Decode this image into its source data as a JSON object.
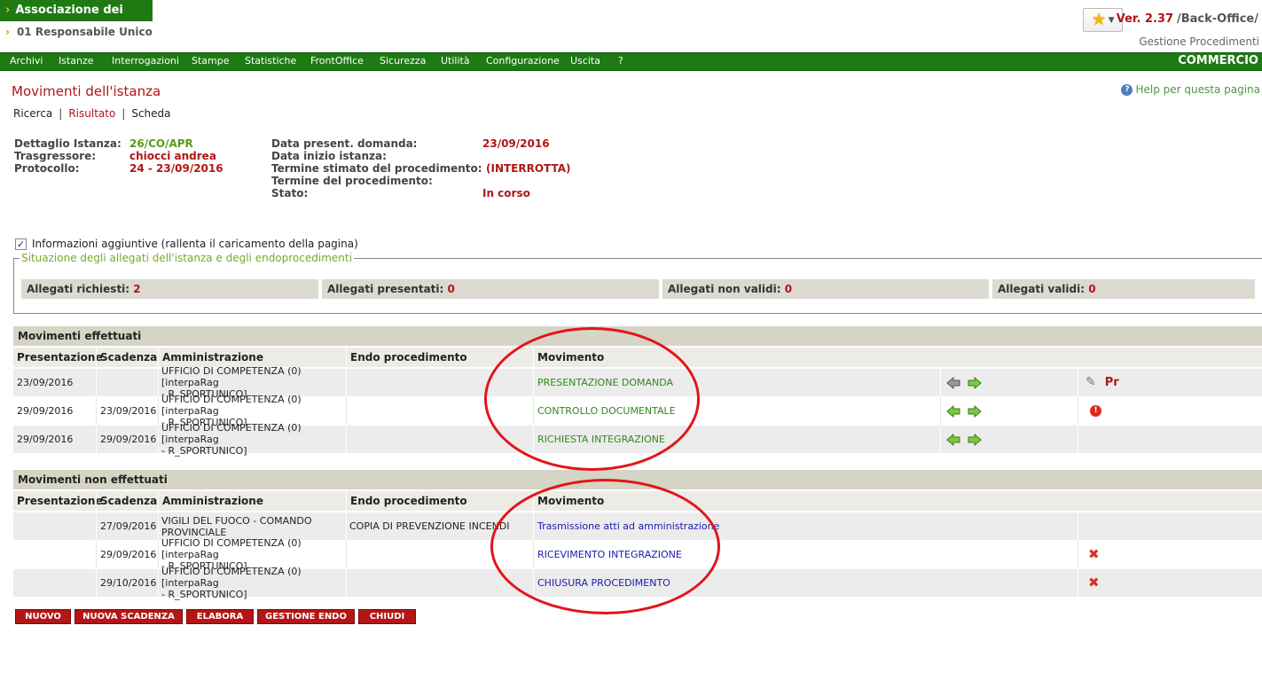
{
  "header": {
    "org_name": "Associazione dei comuni",
    "user": "01 Responsabile Unico",
    "version": "Ver. 2.37",
    "app": "/Back-Office/",
    "module": "Gestione Procedimenti"
  },
  "nav": {
    "items": [
      "Archivi",
      "Istanze",
      "Interrogazioni",
      "Stampe",
      "Statistiche",
      "FrontOffice",
      "Sicurezza",
      "Utilità",
      "Configurazione",
      "Uscita",
      "?"
    ],
    "right_label": "COMMERCIO"
  },
  "page": {
    "title": "Movimenti dell'istanza",
    "help": "Help per questa pagina",
    "breadcrumb": [
      "Ricerca",
      "Risultato",
      "Scheda"
    ]
  },
  "detail": {
    "left": [
      {
        "label": "Dettaglio Istanza:",
        "value": "26/CO/APR"
      },
      {
        "label": "Trasgressore:",
        "value": "chiocci andrea"
      },
      {
        "label": "Protocollo:",
        "value": "24 - 23/09/2016"
      }
    ],
    "right": [
      {
        "label": "Data present. domanda:",
        "value": "23/09/2016"
      },
      {
        "label": "Data inizio istanza:",
        "value": ""
      },
      {
        "label": "Termine stimato del procedimento:",
        "value": "(INTERROTTA)"
      },
      {
        "label": "Termine del procedimento:",
        "value": ""
      },
      {
        "label": "Stato:",
        "value": "In corso"
      }
    ]
  },
  "info": {
    "checkbox_label": "Informazioni aggiuntive (rallenta il caricamento della pagina)",
    "checked": true,
    "legend": "Situazione degli allegati dell'istanza e degli endoprocedimenti",
    "allegati": [
      {
        "label": "Allegati richiesti:",
        "value": "2"
      },
      {
        "label": "Allegati presentati:",
        "value": "0"
      },
      {
        "label": "Allegati non validi:",
        "value": "0"
      },
      {
        "label": "Allegati validi:",
        "value": "0"
      }
    ]
  },
  "columns": [
    "Presentazione",
    "Scadenza",
    "Amministrazione",
    "Endo procedimento",
    "Movimento"
  ],
  "effettuati": {
    "title": "Movimenti effettuati",
    "rows": [
      {
        "presentazione": "23/09/2016",
        "scadenza": "",
        "amm1": "UFFICIO DI COMPETENZA (0) [interpaRag",
        "amm2": "- R_SPORTUNICO]",
        "endo": "",
        "movimento": "PRESENTAZIONE DOMANDA",
        "pr": "Pr"
      },
      {
        "presentazione": "29/09/2016",
        "scadenza": "23/09/2016",
        "amm1": "UFFICIO DI COMPETENZA (0) [interpaRag",
        "amm2": "- R_SPORTUNICO]",
        "endo": "",
        "movimento": "CONTROLLO DOCUMENTALE"
      },
      {
        "presentazione": "29/09/2016",
        "scadenza": "29/09/2016",
        "amm1": "UFFICIO DI COMPETENZA (0) [interpaRag",
        "amm2": "- R_SPORTUNICO]",
        "endo": "",
        "movimento": "RICHIESTA INTEGRAZIONE"
      }
    ]
  },
  "non_effettuati": {
    "title": "Movimenti non effettuati",
    "rows": [
      {
        "presentazione": "",
        "scadenza": "27/09/2016",
        "amm1": "VIGILI DEL FUOCO - COMANDO",
        "amm2": "PROVINCIALE",
        "endo": "COPIA DI PREVENZIONE INCENDI",
        "movimento": "Trasmissione atti ad amministrazione"
      },
      {
        "presentazione": "",
        "scadenza": "29/09/2016",
        "amm1": "UFFICIO DI COMPETENZA (0) [interpaRag",
        "amm2": "- R_SPORTUNICO]",
        "endo": "",
        "movimento": "RICEVIMENTO INTEGRAZIONE"
      },
      {
        "presentazione": "",
        "scadenza": "29/10/2016",
        "amm1": "UFFICIO DI COMPETENZA (0) [interpaRag",
        "amm2": "- R_SPORTUNICO]",
        "endo": "",
        "movimento": "CHIUSURA PROCEDIMENTO"
      }
    ]
  },
  "buttons": [
    "NUOVO",
    "NUOVA SCADENZA",
    "ELABORA",
    "GESTIONE ENDO",
    "CHIUDI"
  ],
  "icons": {
    "star": "star-icon",
    "arrows": "green-arrow-icon",
    "attachment": "paperclip-icon",
    "alert": "alert-icon",
    "delete": "delete-x-icon",
    "help": "help-icon"
  },
  "colors": {
    "brand_green": "#1f7a14",
    "accent_red": "#b01616",
    "annotation_red": "#e3141a"
  }
}
